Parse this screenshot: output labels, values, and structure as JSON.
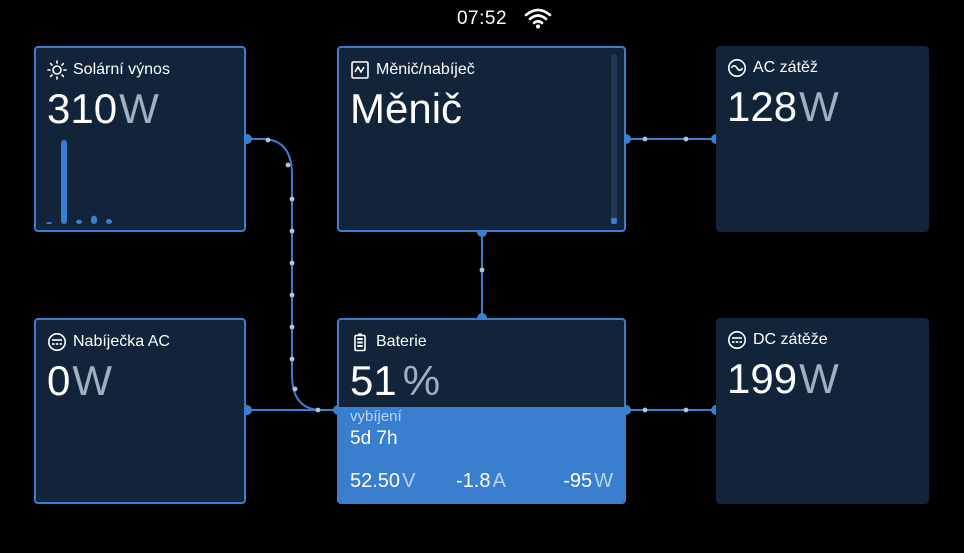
{
  "status_bar": {
    "time": "07:52",
    "wifi_icon": "wifi-icon"
  },
  "colors": {
    "background": "#000000",
    "card": "#11243a",
    "accent": "#3a7fcf",
    "unit_text": "#9fb0c3"
  },
  "solar": {
    "title": "Solární výnos",
    "icon": "sun-icon",
    "value": "310",
    "unit": "W",
    "history_levels": [
      0.0,
      1.0,
      0.05,
      0.1,
      0.06
    ]
  },
  "inverter": {
    "title": "Měnič/nabíječ",
    "icon": "inverter-icon",
    "mode": "Měnič"
  },
  "ac_loads": {
    "title": "AC zátěž",
    "icon": "sine-wave-icon",
    "value": "128",
    "unit": "W"
  },
  "ac_charger": {
    "title": "Nabíječka AC",
    "icon": "charger-icon",
    "value": "0",
    "unit": "W"
  },
  "battery": {
    "title": "Baterie",
    "icon": "battery-icon",
    "soc": "51",
    "soc_unit": "%",
    "state": "vybíjení",
    "time_to_go": "5d 7h",
    "voltage": "52.50",
    "voltage_unit": "V",
    "current": "-1.8",
    "current_unit": "A",
    "power": "-95",
    "power_unit": "W"
  },
  "dc_loads": {
    "title": "DC zátěže",
    "icon": "dc-icon",
    "value": "199",
    "unit": "W"
  }
}
